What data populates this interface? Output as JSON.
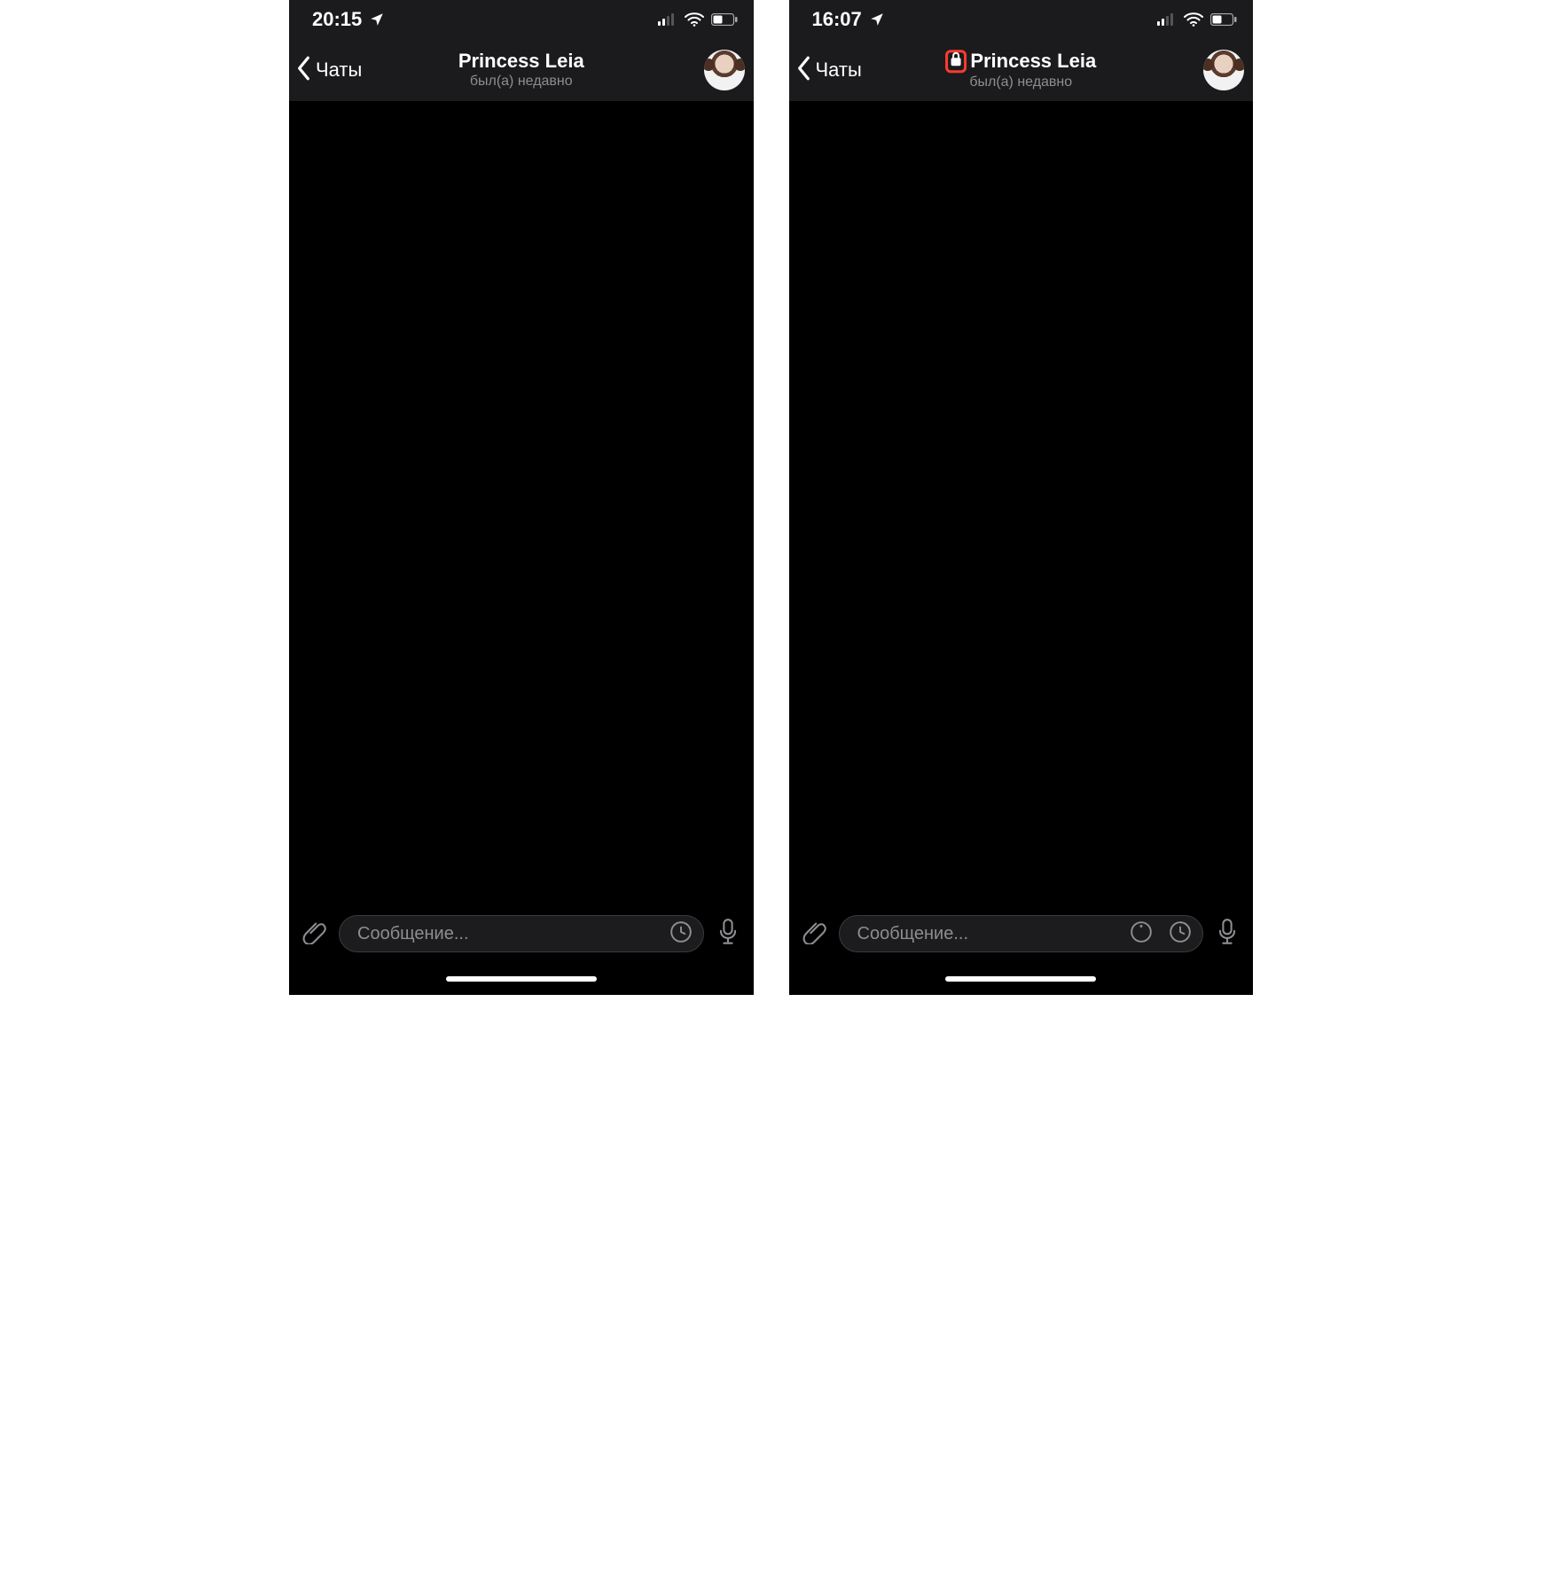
{
  "screens": [
    {
      "statusbar": {
        "time": "20:15"
      },
      "nav": {
        "back_label": "Чаты",
        "title": "Princess Leia",
        "subtitle": "был(а) недавно",
        "show_lock": false
      },
      "input": {
        "placeholder": "Сообщение...",
        "show_self_destruct_timer": false
      }
    },
    {
      "statusbar": {
        "time": "16:07"
      },
      "nav": {
        "back_label": "Чаты",
        "title": "Princess Leia",
        "subtitle": "был(а) недавно",
        "show_lock": true
      },
      "input": {
        "placeholder": "Сообщение...",
        "show_self_destruct_timer": true
      }
    }
  ],
  "icons": {
    "location": "location-arrow-icon",
    "signal": "cell-signal-icon",
    "wifi": "wifi-icon",
    "battery": "battery-icon",
    "chevron_left": "chevron-left-icon",
    "lock": "lock-icon",
    "attach": "paperclip-icon",
    "sticker": "sticker-clock-icon",
    "timer": "self-destruct-timer-icon",
    "mic": "microphone-icon"
  },
  "colors": {
    "highlight": "#ff3b30",
    "muted": "#8d8d92",
    "header_bg": "#1b1b1d",
    "bg": "#000000"
  }
}
